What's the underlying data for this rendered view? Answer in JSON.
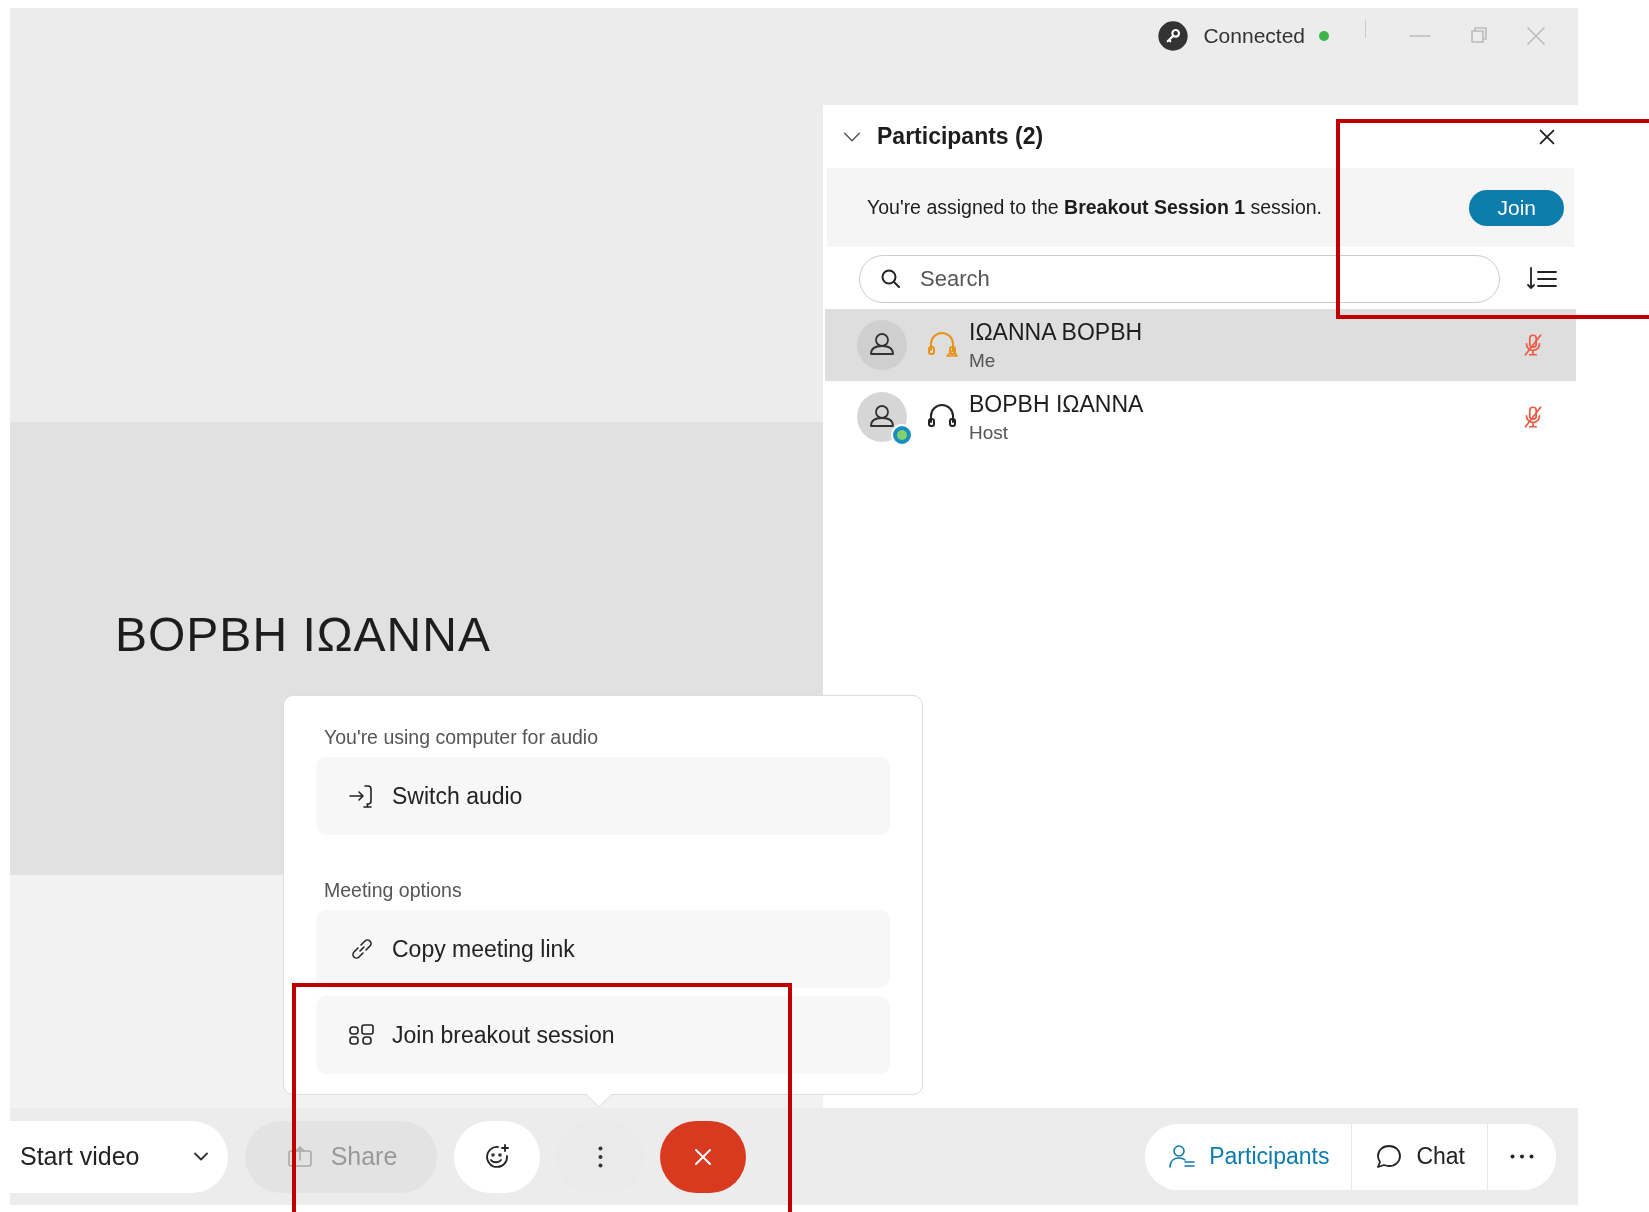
{
  "connection": {
    "label": "Connected",
    "online": true
  },
  "stage": {
    "name": "BOPBH IΩANNA"
  },
  "participants_panel": {
    "title": "Participants (2)",
    "expanded": true,
    "banner": {
      "text": "You're assigned to the **Breakout Session 1** session.",
      "button": "Join"
    },
    "search": {
      "placeholder": "Search"
    },
    "participants": [
      {
        "name": "IΩANNA BOPBH",
        "role": "Me",
        "selected": true,
        "speaking": true,
        "host_badge": false,
        "muted": true
      },
      {
        "name": "BOPBH IΩANNA",
        "role": "Host",
        "selected": false,
        "speaking": false,
        "host_badge": true,
        "muted": true
      }
    ]
  },
  "audio_menu": {
    "sections": [
      {
        "heading": "You're using computer for audio",
        "items": [
          {
            "label": "Switch audio",
            "kind": "switch"
          }
        ]
      },
      {
        "heading": "Meeting options",
        "items": [
          {
            "label": "Copy meeting link",
            "kind": "link"
          },
          {
            "label": "Join breakout session",
            "kind": "breakout"
          }
        ]
      }
    ]
  },
  "toolbar": {
    "left": [
      {
        "kind": "video",
        "label": "Start video",
        "disabled": false
      },
      {
        "kind": "share",
        "label": "Share",
        "disabled": true
      },
      {
        "kind": "reaction"
      },
      {
        "kind": "more"
      },
      {
        "kind": "end"
      }
    ],
    "right": [
      {
        "kind": "participants",
        "label": "Participants",
        "selected": true
      },
      {
        "kind": "chat",
        "label": "Chat",
        "selected": false
      },
      {
        "kind": "more",
        "selected": false
      }
    ]
  }
}
